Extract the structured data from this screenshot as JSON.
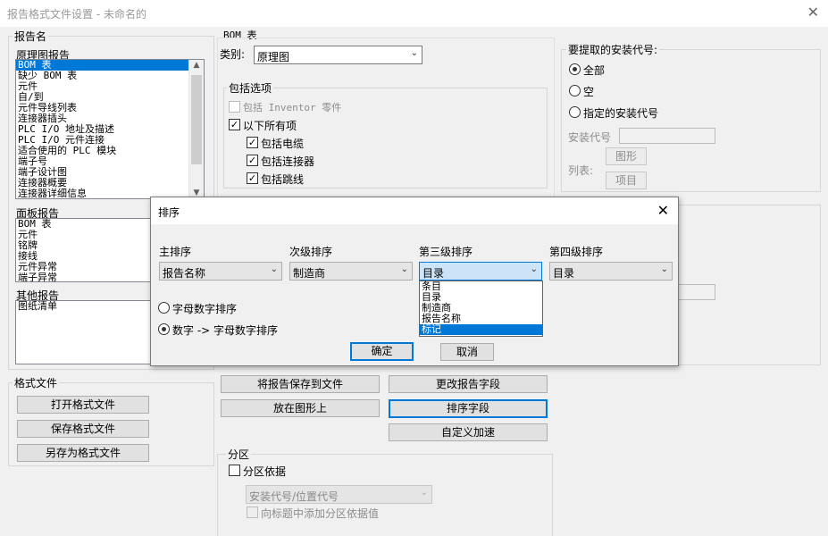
{
  "window": {
    "title": "报告格式文件设置 - 未命名的",
    "close_glyph": "✕"
  },
  "report_name": {
    "group_label": "报告名",
    "schematic": {
      "label": "原理图报告",
      "items": [
        "BOM 表",
        "缺少 BOM 表",
        "元件",
        "自/到",
        "元件导线列表",
        "连接器插头",
        "PLC I/O 地址及描述",
        "PLC I/O 元件连接",
        "适合使用的 PLC 模块",
        "端子号",
        "端子设计图",
        "连接器概要",
        "连接器详细信息"
      ],
      "selected_index": 0
    },
    "panel": {
      "label": "面板报告",
      "items": [
        "BOM 表",
        "元件",
        "铭牌",
        "接线",
        "元件异常",
        "端子异常"
      ]
    },
    "other": {
      "label": "其他报告",
      "items": [
        "图纸清单"
      ]
    }
  },
  "format_file": {
    "group_label": "格式文件",
    "open": "打开格式文件",
    "save": "保存格式文件",
    "save_as": "另存为格式文件"
  },
  "bom": {
    "section_label": "BOM 表",
    "category_label": "类别:",
    "category_value": "原理图",
    "include_options": {
      "label": "包括选项",
      "inventor": "包括 Inventor 零件",
      "all_below": "以下所有项",
      "cables": "包括电缆",
      "connectors": "包括连接器",
      "jumpers": "包括跳线"
    }
  },
  "install_code": {
    "group_label": "要提取的安装代号:",
    "all": "全部",
    "empty": "空",
    "specified": "指定的安装代号",
    "code_label": "安装代号",
    "list_label": "列表:",
    "drawing_button": "图形",
    "project_button": "项目"
  },
  "actions": {
    "save_report": "将报告保存到文件",
    "change_fields": "更改报告字段",
    "put_on_drawing": "放在图形上",
    "sort_fields": "排序字段",
    "custom_plugin": "自定义加速"
  },
  "partition": {
    "group_label": "分区",
    "partition_by": "分区依据",
    "combo_value": "安装代号/位置代号",
    "add_to_title": "向标题中添加分区依据值"
  },
  "sort_dialog": {
    "title": "排序",
    "close_glyph": "✕",
    "primary_label": "主排序",
    "primary_value": "报告名称",
    "secondary_label": "次级排序",
    "secondary_value": "制造商",
    "third_label": "第三级排序",
    "third_value": "目录",
    "fourth_label": "第四级排序",
    "fourth_value": "目录",
    "third_options": [
      "条目",
      "目录",
      "制造商",
      "报告名称",
      "标记"
    ],
    "third_highlighted_index": 4,
    "alpha_numeric": "字母数字排序",
    "numeric_then_alpha": "数字 -> 字母数字排序",
    "ok": "确定",
    "cancel": "取消"
  }
}
